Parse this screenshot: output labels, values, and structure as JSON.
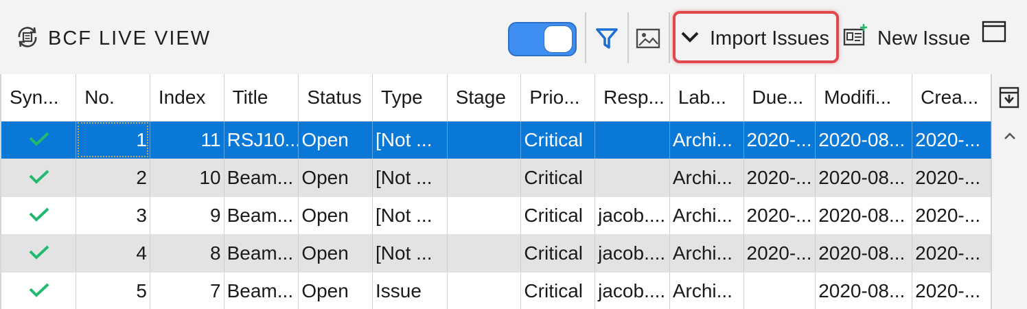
{
  "panel": {
    "title": "BCF LIVE VIEW",
    "live_toggle_on": true,
    "import_label": "Import Issues",
    "new_issue_label": "New Issue"
  },
  "icons": {
    "panel": "sync-refresh-icon",
    "filter": "filter-icon",
    "snapshot": "image-icon",
    "import": "chevron-down-icon",
    "new_issue": "new-issue-card-icon",
    "window": "window-icon",
    "column_chooser": "column-chooser-icon",
    "scroll_up": "chevron-up-icon",
    "synced": "check-icon"
  },
  "colors": {
    "accent": "#3d8ef0",
    "selection": "#0a78d7",
    "highlight": "#e0484b",
    "check": "#1fba6e",
    "filter": "#1e6fd1"
  },
  "table": {
    "columns": [
      "Syn...",
      "No.",
      "Index",
      "Title",
      "Status",
      "Type",
      "Stage",
      "Prio...",
      "Resp...",
      "Lab...",
      "Due...",
      "Modifi...",
      "Crea..."
    ],
    "rows": [
      {
        "no": "1",
        "index": "11",
        "title": "RSJ10...",
        "status": "Open",
        "type": "[Not ...",
        "stage": "",
        "priority": "Critical",
        "responsible": "",
        "labels": "Archi...",
        "due": "2020-...",
        "modified": "2020-08...",
        "created": "2020-..."
      },
      {
        "no": "2",
        "index": "10",
        "title": "Beam...",
        "status": "Open",
        "type": "[Not ...",
        "stage": "",
        "priority": "Critical",
        "responsible": "",
        "labels": "Archi...",
        "due": "2020-...",
        "modified": "2020-08...",
        "created": "2020-..."
      },
      {
        "no": "3",
        "index": "9",
        "title": "Beam...",
        "status": "Open",
        "type": "[Not ...",
        "stage": "",
        "priority": "Critical",
        "responsible": "jacob....",
        "labels": "Archi...",
        "due": "2020-...",
        "modified": "2020-08...",
        "created": "2020-..."
      },
      {
        "no": "4",
        "index": "8",
        "title": "Beam...",
        "status": "Open",
        "type": "[Not ...",
        "stage": "",
        "priority": "Critical",
        "responsible": "jacob....",
        "labels": "Archi...",
        "due": "2020-...",
        "modified": "2020-08...",
        "created": "2020-..."
      },
      {
        "no": "5",
        "index": "7",
        "title": "Beam...",
        "status": "Open",
        "type": "Issue",
        "stage": "",
        "priority": "Critical",
        "responsible": "jacob....",
        "labels": "Archi...",
        "due": "",
        "modified": "2020-08...",
        "created": "2020-..."
      }
    ]
  }
}
